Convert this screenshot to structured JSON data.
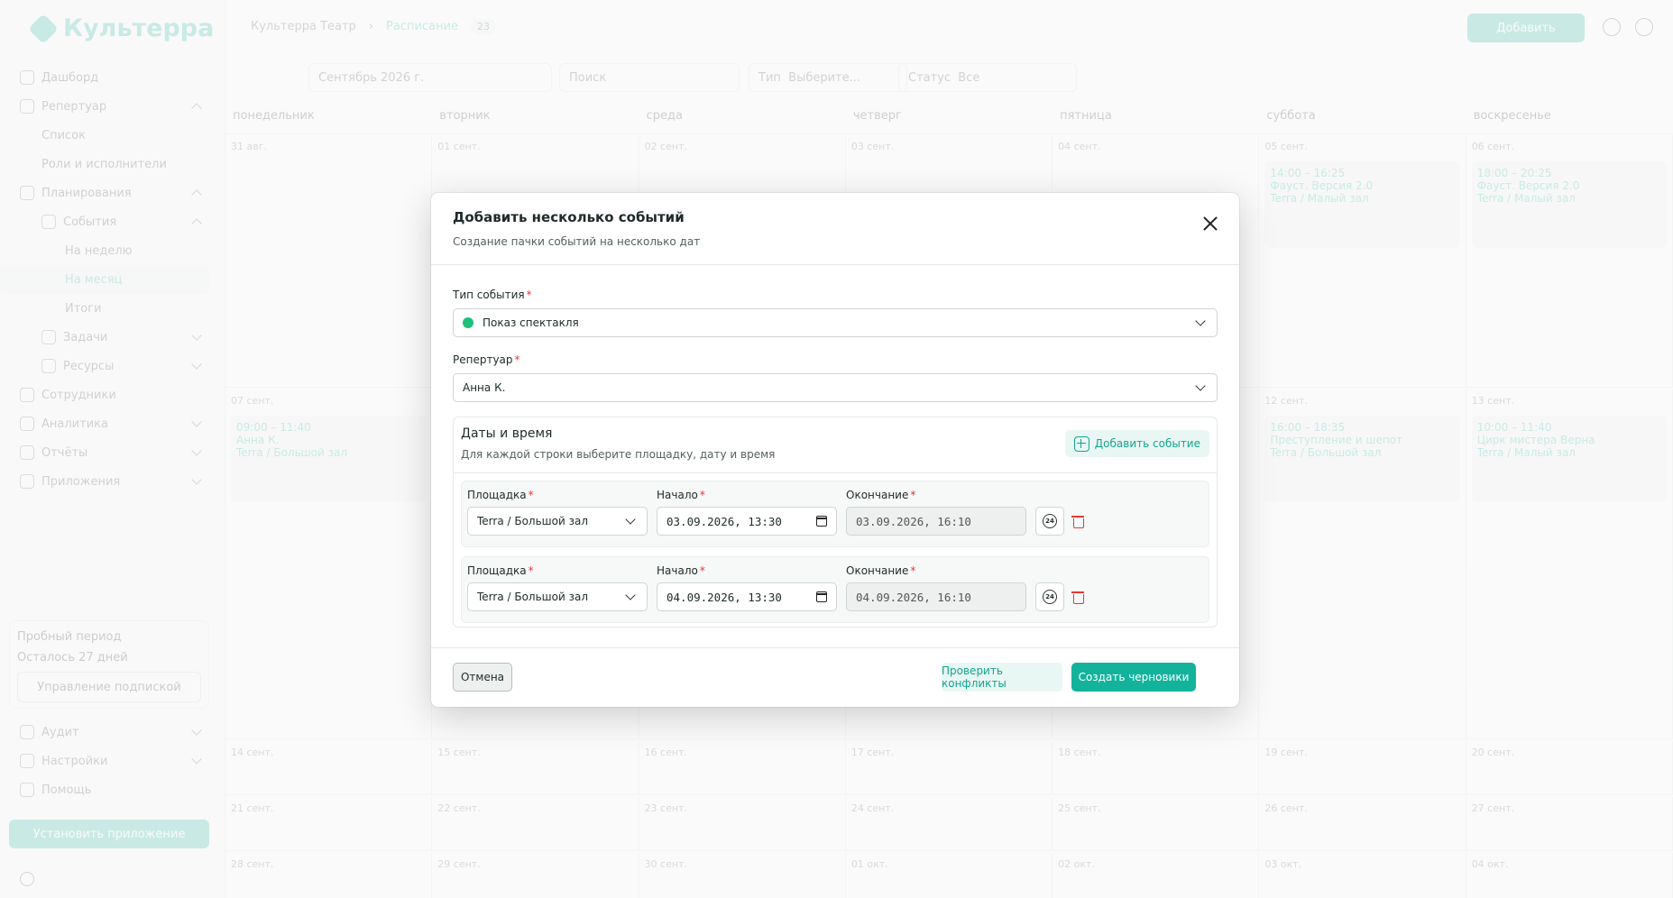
{
  "app": {
    "logo": "Культерра",
    "nav": [
      {
        "label": "Дашборд"
      },
      {
        "label": "Репертуар"
      },
      {
        "label": "Список"
      },
      {
        "label": "Роли и исполнители"
      },
      {
        "label": "Планирования"
      },
      {
        "label": "События"
      },
      {
        "label": "На неделю"
      },
      {
        "label": "На месяц"
      },
      {
        "label": "Итоги"
      },
      {
        "label": "Задачи"
      },
      {
        "label": "Ресурсы"
      },
      {
        "label": "Сотрудники"
      },
      {
        "label": "Аналитика"
      },
      {
        "label": "Отчёты"
      },
      {
        "label": "Приложения"
      }
    ],
    "trial": {
      "title": "Пробный период",
      "remaining": "Осталось 27 дней",
      "manage": "Управление подпиской"
    },
    "nav2": [
      {
        "label": "Аудит"
      },
      {
        "label": "Настройки"
      },
      {
        "label": "Помощь"
      }
    ],
    "install": "Установить приложение",
    "breadcrumb": {
      "root": "Культерра Театр",
      "current": "Расписание",
      "count": "23"
    },
    "add_button": "Добавить",
    "filters": {
      "month": "Сентябрь 2026 г.",
      "search_placeholder": "Поиск",
      "type_label": "Тип",
      "type_placeholder": "Выберите...",
      "status_label": "Статус",
      "status_value": "Все"
    },
    "weekdays": [
      "понедельник",
      "вторник",
      "среда",
      "четверг",
      "пятница",
      "суббота",
      "воскресенье"
    ],
    "weeks": [
      [
        "31 авг.",
        "01 сент.",
        "02 сент.",
        "03 сент.",
        "04 сент.",
        "05 сент.",
        "06 сент."
      ],
      [
        "07 сент.",
        "",
        "",
        "",
        "",
        "12 сент.",
        "13 сент."
      ],
      [
        "14 сент.",
        "15 сент.",
        "16 сент.",
        "17 сент.",
        "18 сент.",
        "19 сент.",
        "20 сент."
      ],
      [
        "21 сент.",
        "22 сент.",
        "23 сент.",
        "24 сент.",
        "25 сент.",
        "26 сент.",
        "27 сент."
      ],
      [
        "28 сент.",
        "29 сент.",
        "30 сент.",
        "01 окт.",
        "02 окт.",
        "03 окт.",
        "04 окт."
      ]
    ],
    "events": {
      "sat1": {
        "time": "14:00 – 16:25",
        "title": "Фауст. Версия 2.0",
        "place": "Terra / Малый зал"
      },
      "sun1": {
        "time": "18:00 – 20:25",
        "title": "Фауст. Версия 2.0",
        "place": "Terra / Малый зал"
      },
      "mon2": {
        "time": "09:00 – 11:40",
        "title": "Анна К.",
        "place": "Terra / Большой зал"
      },
      "sat2": {
        "time": "16:00 – 18:35",
        "title": "Преступление и шепот",
        "place": "Terra / Большой зал"
      },
      "sun2": {
        "time": "10:00 – 11:40",
        "title": "Цирк мистера Верна",
        "place": "Terra / Малый зал"
      }
    }
  },
  "modal": {
    "title": "Добавить несколько событий",
    "subtitle": "Создание пачки событий на несколько дат",
    "event_type_label": "Тип события",
    "event_type_value": "Показ спектакля",
    "event_type_color": "#1ec07a",
    "repertoire_label": "Репертуар",
    "repertoire_value": "Анна К.",
    "dates_title": "Даты и время",
    "dates_subtitle": "Для каждой строки выберите площадку, дату и время",
    "add_event": "Добавить событие",
    "rows": [
      {
        "venue_label": "Площадка",
        "venue": "Terra / Большой зал",
        "start_label": "Начало",
        "start": "03.09.2026, 13:30",
        "end_label": "Окончание",
        "end": "03.09.2026, 16:10"
      },
      {
        "venue_label": "Площадка",
        "venue": "Terra / Большой зал",
        "start_label": "Начало",
        "start": "04.09.2026, 13:30",
        "end_label": "Окончание",
        "end": "04.09.2026, 16:10"
      }
    ],
    "h24": "24",
    "cancel": "Отмена",
    "check_conflicts": "Проверить конфликты",
    "create_drafts": "Создать черновики"
  }
}
